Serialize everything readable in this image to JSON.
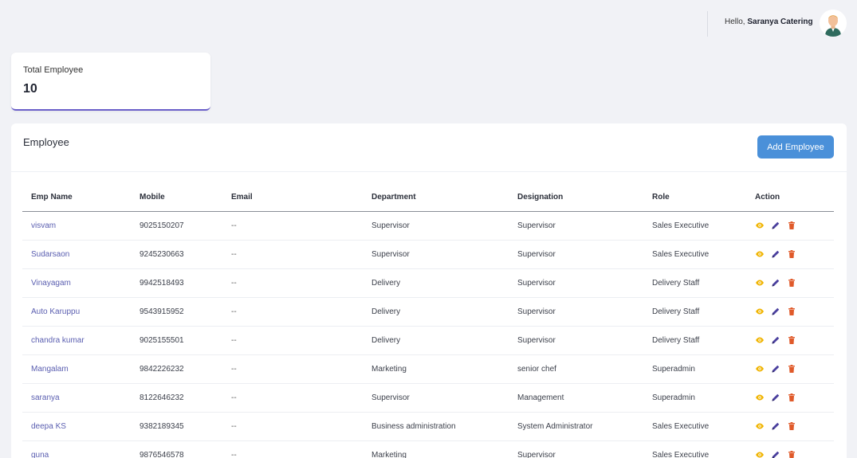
{
  "header": {
    "greeting_prefix": "Hello,",
    "user_name": "Saranya Catering"
  },
  "stats": {
    "label": "Total Employee",
    "value": "10"
  },
  "panel": {
    "title": "Employee",
    "add_button_label": "Add Employee"
  },
  "table": {
    "columns": [
      "Emp Name",
      "Mobile",
      "Email",
      "Department",
      "Designation",
      "Role",
      "Action"
    ],
    "rows": [
      {
        "name": "visvam",
        "mobile": "9025150207",
        "email": "--",
        "department": "Supervisor",
        "designation": "Supervisor",
        "role": "Sales Executive"
      },
      {
        "name": "Sudarsaon",
        "mobile": "9245230663",
        "email": "--",
        "department": "Supervisor",
        "designation": "Supervisor",
        "role": "Sales Executive"
      },
      {
        "name": "Vinayagam",
        "mobile": "9942518493",
        "email": "--",
        "department": "Delivery",
        "designation": "Supervisor",
        "role": "Delivery Staff"
      },
      {
        "name": "Auto Karuppu",
        "mobile": "9543915952",
        "email": "--",
        "department": "Delivery",
        "designation": "Supervisor",
        "role": "Delivery Staff"
      },
      {
        "name": "chandra kumar",
        "mobile": "9025155501",
        "email": "--",
        "department": "Delivery",
        "designation": "Supervisor",
        "role": "Delivery Staff"
      },
      {
        "name": "Mangalam",
        "mobile": "9842226232",
        "email": "--",
        "department": "Marketing",
        "designation": "senior chef",
        "role": "Superadmin"
      },
      {
        "name": "saranya",
        "mobile": "8122646232",
        "email": "--",
        "department": "Supervisor",
        "designation": "Management",
        "role": "Superadmin"
      },
      {
        "name": "deepa KS",
        "mobile": "9382189345",
        "email": "--",
        "department": "Business administration",
        "designation": "System Administrator",
        "role": "Sales Executive"
      },
      {
        "name": "guna",
        "mobile": "9876546578",
        "email": "--",
        "department": "Marketing",
        "designation": "Supervisor",
        "role": "Sales Executive"
      }
    ]
  },
  "colors": {
    "view_icon": "#f0b400",
    "edit_icon": "#4a3f9e",
    "delete_icon": "#e05a2a",
    "accent": "#4a90d9"
  },
  "icons": [
    "eye-icon",
    "pencil-icon",
    "trash-icon"
  ]
}
